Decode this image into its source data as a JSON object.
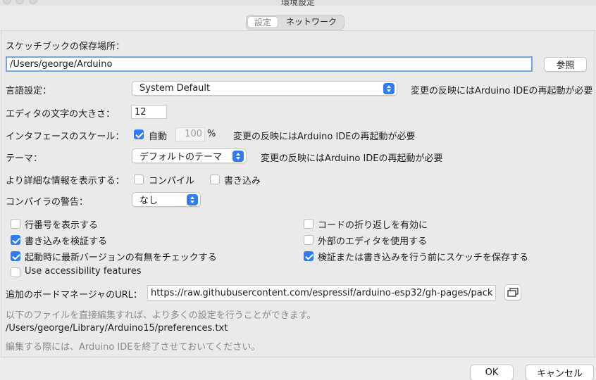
{
  "window": {
    "title": "環境設定"
  },
  "tabs": [
    {
      "label": "設定"
    },
    {
      "label": "ネットワーク"
    }
  ],
  "sketchbook": {
    "label": "スケッチブックの保存場所：",
    "path": "/Users/george/Arduino",
    "browse_label": "参照"
  },
  "language": {
    "label": "言語設定：",
    "value": "System Default",
    "note": "変更の反映にはArduino IDEの再起動が必要"
  },
  "font_size": {
    "label": "エディタの文字の大きさ：",
    "value": "12"
  },
  "scale": {
    "label": "インタフェースのスケール：",
    "auto_label": "自動",
    "auto_checked": true,
    "value": "100",
    "unit": "%",
    "note": "変更の反映にはArduino IDEの再起動が必要"
  },
  "theme": {
    "label": "テーマ：",
    "value": "デフォルトのテーマ",
    "note": "変更の反映にはArduino IDEの再起動が必要"
  },
  "verbose": {
    "label": "より詳細な情報を表示する：",
    "compile_label": "コンパイル",
    "compile_checked": false,
    "upload_label": "書き込み",
    "upload_checked": false
  },
  "warnings": {
    "label": "コンパイラの警告：",
    "value": "なし"
  },
  "options_left": [
    {
      "label": "行番号を表示する",
      "checked": false
    },
    {
      "label": "書き込みを検証する",
      "checked": true
    },
    {
      "label": "起動時に最新バージョンの有無をチェックする",
      "checked": true
    },
    {
      "label": "Use accessibility features",
      "checked": false
    }
  ],
  "options_right": [
    {
      "label": "コードの折り返しを有効に",
      "checked": false
    },
    {
      "label": "外部のエディタを使用する",
      "checked": false
    },
    {
      "label": "検証または書き込みを行う前にスケッチを保存する",
      "checked": true
    }
  ],
  "boards_url": {
    "label": "追加のボードマネージャのURL：",
    "value": "https://raw.githubusercontent.com/espressif/arduino-esp32/gh-pages/pack"
  },
  "info": {
    "line1": "以下のファイルを直接編集すれば、より多くの設定を行うことができます。",
    "path": "/Users/george/Library/Arduino15/preferences.txt",
    "line2": "編集する際には、Arduino IDEを終了させておいてください。"
  },
  "footer": {
    "ok_label": "OK",
    "cancel_label": "キャンセル"
  },
  "colors": {
    "accent": "#2f7cf6",
    "focus_ring": "#76a6e6"
  }
}
